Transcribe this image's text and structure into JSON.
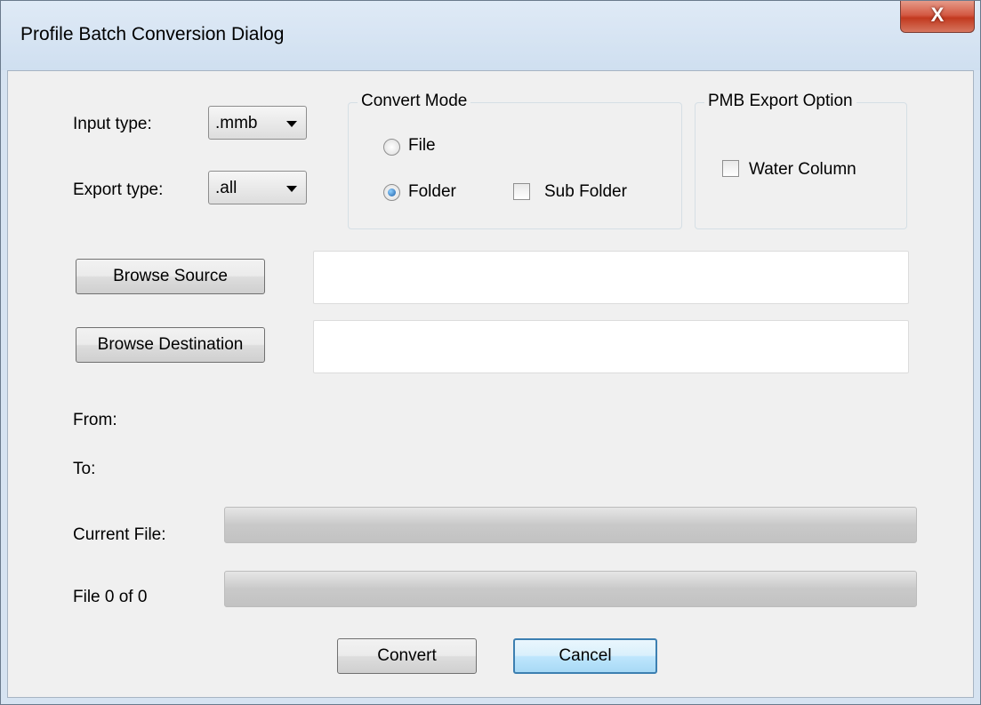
{
  "window": {
    "title": "Profile Batch Conversion Dialog",
    "close_glyph": "X"
  },
  "input_type": {
    "label": "Input type:",
    "value": ".mmb"
  },
  "export_type": {
    "label": "Export type:",
    "value": ".all"
  },
  "convert_mode": {
    "title": "Convert Mode",
    "file_label": "File",
    "file_checked": false,
    "folder_label": "Folder",
    "folder_checked": true,
    "sub_folder_label": "Sub Folder",
    "sub_folder_checked": false
  },
  "pmb_export": {
    "title": "PMB Export Option",
    "water_column_label": "Water Column",
    "water_column_checked": false
  },
  "browse_source": {
    "label": "Browse Source",
    "path": ""
  },
  "browse_destination": {
    "label": "Browse Destination",
    "path": ""
  },
  "from_label": "From:",
  "to_label": "To:",
  "current_file": {
    "label": "Current File:",
    "progress": 0
  },
  "file_count": {
    "label": "File 0 of 0",
    "progress": 0
  },
  "buttons": {
    "convert": "Convert",
    "cancel": "Cancel"
  },
  "colors": {
    "default_button_border": "#3c7fb1",
    "close_button": "#c2391f",
    "background": "#f0f0f0"
  },
  "icons": {
    "close": "close-icon",
    "dropdown": "chevron-down-icon"
  }
}
